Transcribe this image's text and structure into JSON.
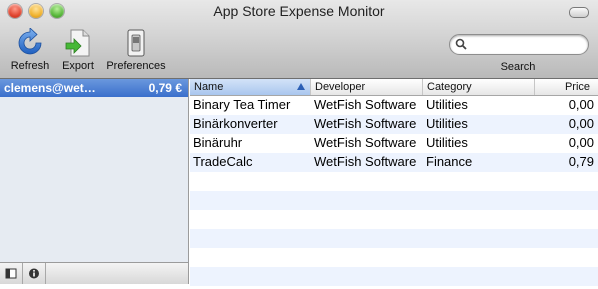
{
  "window": {
    "title": "App Store Expense Monitor"
  },
  "toolbar": {
    "refresh_label": "Refresh",
    "export_label": "Export",
    "preferences_label": "Preferences",
    "search_label": "Search",
    "search_placeholder": "",
    "search_value": ""
  },
  "sidebar": {
    "account": {
      "name": "clemens@wet…",
      "total": "0,79 €"
    }
  },
  "table": {
    "columns": [
      "Name",
      "Developer",
      "Category",
      "Price"
    ],
    "sorted_by": "Name",
    "rows": [
      {
        "name": "Binary Tea Timer",
        "developer": "WetFish Software",
        "category": "Utilities",
        "price": "0,00"
      },
      {
        "name": "Binärkonverter",
        "developer": "WetFish Software",
        "category": "Utilities",
        "price": "0,00"
      },
      {
        "name": "Binäruhr",
        "developer": "WetFish Software",
        "category": "Utilities",
        "price": "0,00"
      },
      {
        "name": "TradeCalc",
        "developer": "WetFish Software",
        "category": "Finance",
        "price": "0,79"
      }
    ]
  },
  "colors": {
    "selection": "#3a6fcc",
    "header_sorted": "#a9c6ee",
    "row_alt": "#edf3fe",
    "sidebar_bg": "#e6ebf2"
  }
}
